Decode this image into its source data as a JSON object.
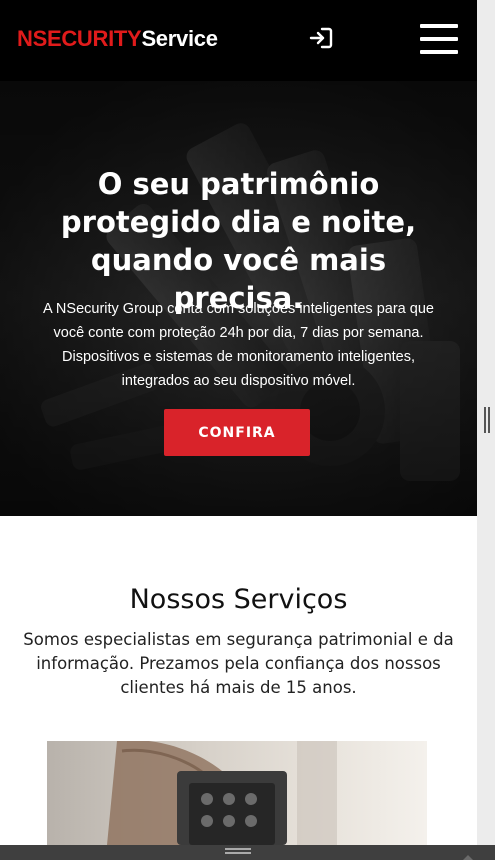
{
  "header": {
    "logo_primary": "NSECURITY",
    "logo_secondary": "Service",
    "login_icon": "login-icon",
    "menu_icon": "hamburger-menu-icon"
  },
  "hero": {
    "title": "O seu patrimônio protegido dia e noite, quando você mais precisa.",
    "text": "A NSecurity Group conta com soluções inteligentes para que você conte com proteção 24h por dia, 7 dias por semana. Dispositivos e sistemas de monitoramento inteligentes, integrados ao seu dispositivo móvel.",
    "cta_label": "CONFIRA"
  },
  "services": {
    "title": "Nossos Serviços",
    "text": "Somos especialistas em segurança patrimonial e da informação. Prezamos pela confiança dos nossos clientes há mais de 15 anos."
  },
  "colors": {
    "brand_red": "#e01b1b",
    "button_red": "#d9232a",
    "header_bg": "#000000"
  }
}
